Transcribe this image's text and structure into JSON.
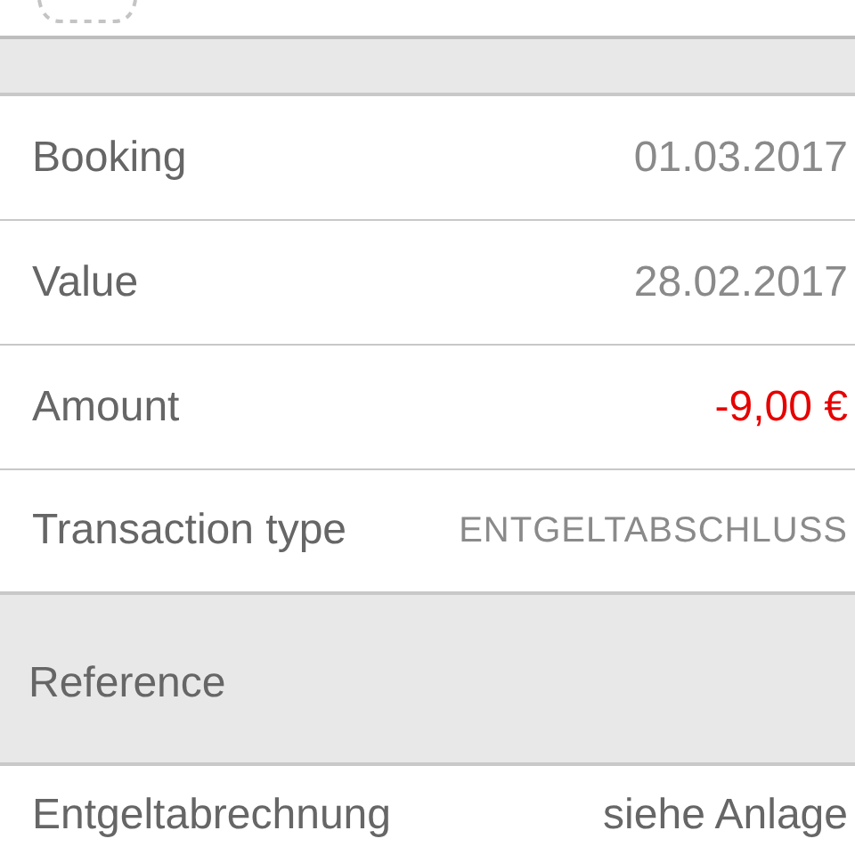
{
  "details": [
    {
      "label": "Booking",
      "value": "01.03.2017",
      "negative": false,
      "kind": "plain"
    },
    {
      "label": "Value",
      "value": "28.02.2017",
      "negative": false,
      "kind": "plain"
    },
    {
      "label": "Amount",
      "value": "-9,00 €",
      "negative": true,
      "kind": "plain"
    },
    {
      "label": "Transaction type",
      "value": "ENTGELTABSCHLUSS",
      "negative": false,
      "kind": "small"
    }
  ],
  "reference": {
    "header": "Reference",
    "rows": [
      {
        "label": "Entgeltabrechnung",
        "value": "siehe Anlage"
      }
    ]
  }
}
